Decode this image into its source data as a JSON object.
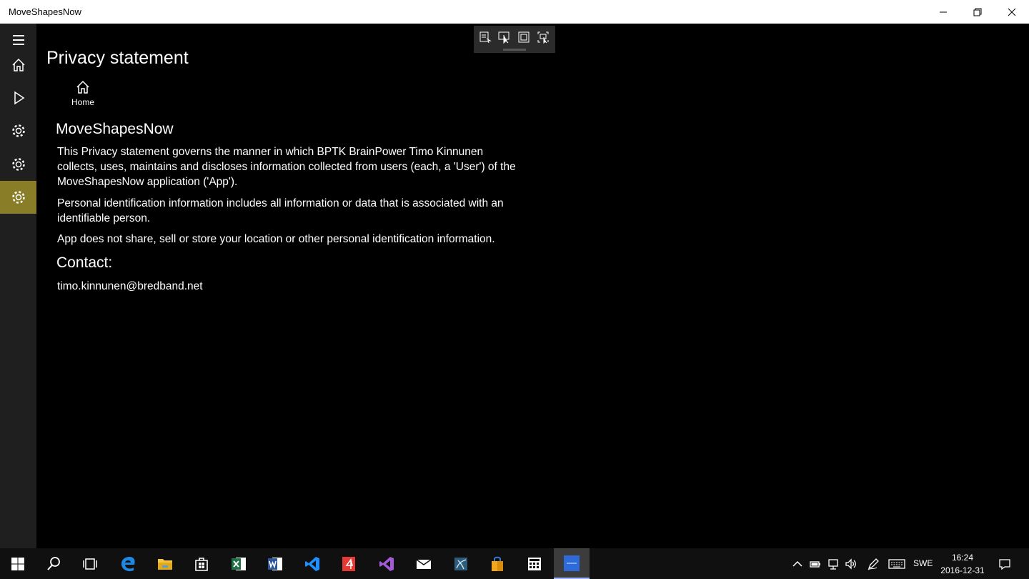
{
  "window": {
    "title": "MoveShapesNow"
  },
  "page": {
    "title": "Privacy statement",
    "home_label": "Home",
    "app_heading": "MoveShapesNow",
    "paragraphs": [
      "This Privacy statement governs the manner in which BPTK BrainPower Timo Kinnunen collects, uses, maintains and discloses information collected from users (each, a 'User') of the MoveShapesNow application ('App').",
      "Personal identification information includes all information or data that is associated with an identifiable person.",
      "App does not share, sell or store your location or other personal identification information."
    ],
    "contact_heading": "Contact:",
    "contact_email": "timo.kinnunen@bredband.net"
  },
  "colors": {
    "rail_background": "#1f1f1f",
    "rail_active": "#8a7d28",
    "content_background": "#000000",
    "taskbar": "#101010"
  },
  "rail": {
    "items": [
      "hamburger-icon",
      "home-icon",
      "play-icon",
      "gear-icon",
      "gear-icon",
      "gear-icon"
    ],
    "active_index": 5
  },
  "taskbar": {
    "apps": [
      "windows-start-icon",
      "search-icon",
      "task-view-icon",
      "edge-icon",
      "file-explorer-icon",
      "store-icon",
      "excel-icon",
      "word-icon",
      "vscode-icon",
      "pdf-icon",
      "visual-studio-icon",
      "mail-icon",
      "sql-server-icon",
      "shopping-bag-icon",
      "calculator-icon",
      "moveshapesnow-icon"
    ],
    "tray": {
      "language": "SWE",
      "time": "16:24",
      "date": "2016-12-31"
    }
  }
}
